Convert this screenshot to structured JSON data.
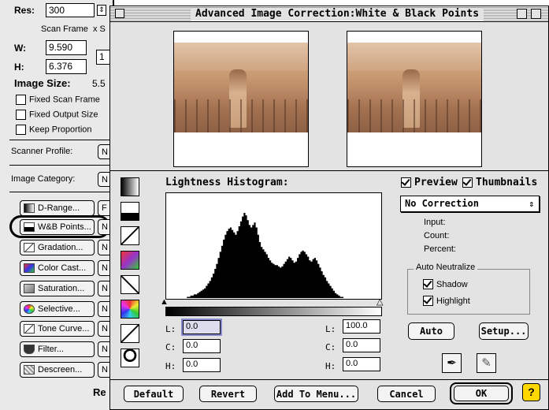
{
  "left_panel": {
    "res_label": "Res:",
    "res_value": "300",
    "scan_frame_label": "Scan Frame",
    "scan_frame_suffix": "x  S",
    "w_label": "W:",
    "w_value": "9.590",
    "h_label": "H:",
    "h_value": "6.376",
    "side_value": "1",
    "image_size_label": "Image Size:",
    "image_size_value": "5.5",
    "checkboxes": [
      {
        "label": "Fixed Scan Frame",
        "checked": false
      },
      {
        "label": "Fixed Output Size",
        "checked": false
      },
      {
        "label": "Keep Proportion",
        "checked": false
      }
    ],
    "scanner_profile_label": "Scanner Profile:",
    "scanner_profile_value": "N",
    "image_category_label": "Image Category:",
    "image_category_value": "N",
    "tools": [
      {
        "label": "D-Range...",
        "side": "F",
        "icon": "d-range-icon"
      },
      {
        "label": "W&B Points...",
        "side": "N",
        "icon": "wb-points-icon"
      },
      {
        "label": "Gradation...",
        "side": "N",
        "icon": "gradation-icon"
      },
      {
        "label": "Color Cast...",
        "side": "N",
        "icon": "color-cast-icon"
      },
      {
        "label": "Saturation...",
        "side": "N",
        "icon": "saturation-icon"
      },
      {
        "label": "Selective...",
        "side": "N",
        "icon": "selective-icon"
      },
      {
        "label": "Tone Curve...",
        "side": "N",
        "icon": "tone-curve-icon"
      },
      {
        "label": "Filter...",
        "side": "N",
        "icon": "filter-icon"
      },
      {
        "label": "Descreen...",
        "side": "N",
        "icon": "descreen-icon"
      }
    ],
    "bottom_label": "Re"
  },
  "dialog": {
    "title": "Advanced Image Correction:White & Black Points",
    "histogram_label": "Lightness Histogram:",
    "preview_label": "Preview",
    "preview_checked": true,
    "thumbnails_label": "Thumbnails",
    "thumbnails_checked": true,
    "correction_select": "No Correction",
    "input_label": "Input:",
    "count_label": "Count:",
    "percent_label": "Percent:",
    "auto_neutralize_label": "Auto Neutralize",
    "shadow_label": "Shadow",
    "shadow_checked": true,
    "highlight_label": "Highlight",
    "highlight_checked": true,
    "auto_button": "Auto",
    "setup_button": "Setup...",
    "black_point": {
      "L_label": "L:",
      "L": "0.0",
      "C_label": "C:",
      "C": "0.0",
      "H_label": "H:",
      "H": "0.0"
    },
    "white_point": {
      "L_label": "L:",
      "L": "100.0",
      "C_label": "C:",
      "C": "0.0",
      "H_label": "H:",
      "H": "0.0"
    },
    "buttons": {
      "default": "Default",
      "revert": "Revert",
      "add_to_menu": "Add To Menu...",
      "cancel": "Cancel",
      "ok": "OK",
      "help": "?"
    }
  },
  "histogram": [
    0,
    0,
    0,
    0,
    0,
    0,
    0,
    0,
    0,
    0,
    0,
    0,
    1,
    1,
    2,
    2,
    3,
    3,
    4,
    5,
    6,
    7,
    8,
    10,
    12,
    14,
    17,
    20,
    24,
    28,
    33,
    38,
    43,
    48,
    52,
    55,
    57,
    58,
    56,
    54,
    52,
    55,
    59,
    63,
    67,
    70,
    68,
    64,
    60,
    58,
    60,
    62,
    58,
    52,
    46,
    42,
    40,
    38,
    36,
    33,
    31,
    29,
    28,
    27,
    27,
    26,
    25,
    26,
    28,
    30,
    32,
    34,
    33,
    31,
    29,
    30,
    33,
    36,
    38,
    39,
    38,
    36,
    34,
    31,
    30,
    32,
    33,
    31,
    28,
    25,
    22,
    19,
    17,
    14,
    12,
    10,
    8,
    6,
    4,
    3,
    2,
    1,
    1,
    0,
    0,
    0,
    0,
    0,
    0,
    0,
    0,
    0,
    0,
    0,
    0,
    0,
    0,
    0,
    0,
    0,
    0,
    0,
    0,
    0,
    0
  ]
}
